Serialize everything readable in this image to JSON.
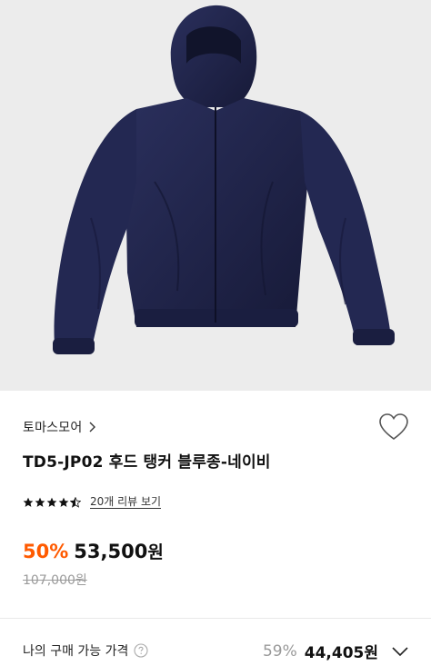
{
  "product": {
    "image_alt_icon": "jacket-product-image",
    "brand": "토마스모어",
    "title": "TD5-JP02 후드 탱커 블루종-네이비",
    "rating": 4.5,
    "review_text": "20개 리뷰 보기",
    "discount": "50%",
    "price": "53,500",
    "price_unit": "원",
    "original_price": "107,000원"
  },
  "my_price": {
    "label": "나의 구매 가능 가격",
    "rate": "59%",
    "price": "44,405",
    "unit": "원"
  },
  "colors": {
    "accent": "#ff5a00",
    "jacket": "#1f2346"
  }
}
